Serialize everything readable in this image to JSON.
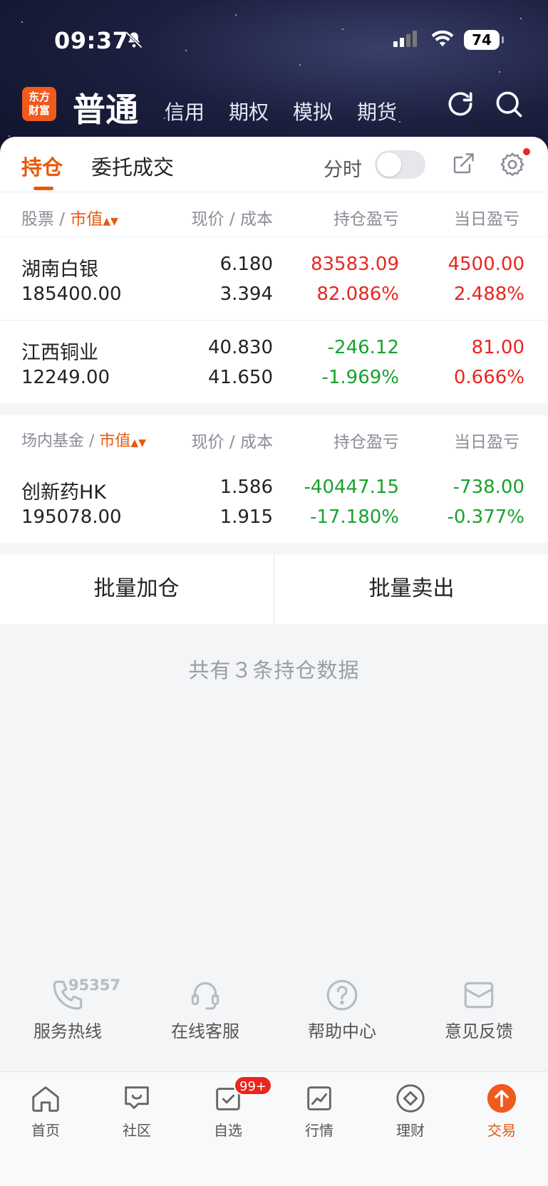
{
  "status_bar": {
    "time": "09:37",
    "battery": "74"
  },
  "header": {
    "logo_text_line1": "东方",
    "logo_text_line2": "财富",
    "account_types": [
      "普通",
      "信用",
      "期权",
      "模拟",
      "期货"
    ],
    "active_account": "普通"
  },
  "tabs": {
    "holdings": "持仓",
    "orders": "委托成交",
    "fenshi_label": "分时",
    "fenshi_on": false
  },
  "stocks": {
    "header": {
      "name": "股票",
      "sort": "市值",
      "price": "现价",
      "cost": "成本",
      "pl": "持仓盈亏",
      "day": "当日盈亏"
    },
    "rows": [
      {
        "name": "湖南白银",
        "market_value": "185400.00",
        "price": "6.180",
        "cost": "3.394",
        "pl": "83583.09",
        "pl_pct": "82.086%",
        "day": "4500.00",
        "day_pct": "2.488%"
      },
      {
        "name": "江西铜业",
        "market_value": "12249.00",
        "price": "40.830",
        "cost": "41.650",
        "pl": "-246.12",
        "pl_pct": "-1.969%",
        "day": "81.00",
        "day_pct": "0.666%"
      }
    ]
  },
  "funds": {
    "header": {
      "name": "场内基金",
      "sort": "市值",
      "price": "现价",
      "cost": "成本",
      "pl": "持仓盈亏",
      "day": "当日盈亏"
    },
    "rows": [
      {
        "name": "创新药HK",
        "market_value": "195078.00",
        "price": "1.586",
        "cost": "1.915",
        "pl": "-40447.15",
        "pl_pct": "-17.180%",
        "day": "-738.00",
        "day_pct": "-0.377%"
      }
    ]
  },
  "actions": {
    "batch_add": "批量加仓",
    "batch_sell": "批量卖出"
  },
  "summary": "共有３条持仓数据",
  "services": {
    "hotline_number": "95357",
    "hotline": "服务热线",
    "online_cs": "在线客服",
    "help": "帮助中心",
    "feedback": "意见反馈"
  },
  "bottom_nav": {
    "home": "首页",
    "community": "社区",
    "watchlist": "自选",
    "watchlist_badge": "99+",
    "market": "行情",
    "wealth": "理财",
    "trade": "交易"
  },
  "colors": {
    "accent": "#e8590c",
    "up": "#e8271f",
    "down": "#1aa12f"
  }
}
